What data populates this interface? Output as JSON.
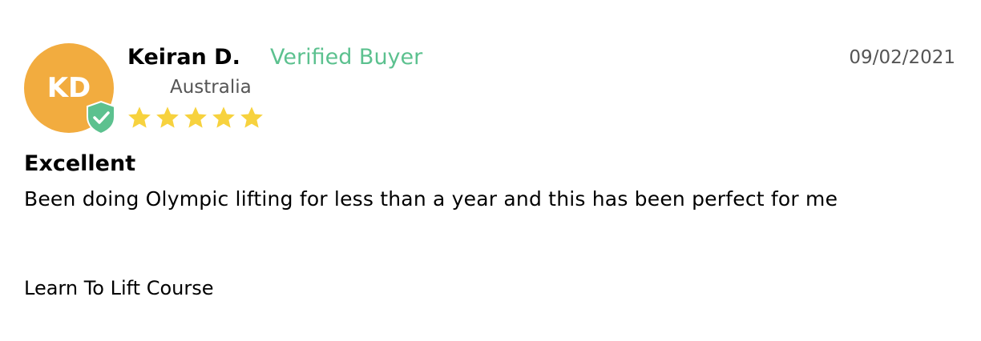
{
  "review": {
    "avatar_initials": "KD",
    "avatar_color": "#f2ac3f",
    "verified_badge_icon": "shield-check-icon",
    "verified_badge_color": "#5cc18f",
    "reviewer_name": "Keiran D.",
    "verified_label": "Verified Buyer",
    "location": "Australia",
    "rating": 5,
    "rating_max": 5,
    "star_icon": "star-icon",
    "star_color": "#f7d23e",
    "date": "09/02/2021",
    "title": "Excellent",
    "body": "Been doing Olympic lifting for less than a year and this has been perfect for me",
    "product_name": "Learn To Lift Course"
  }
}
